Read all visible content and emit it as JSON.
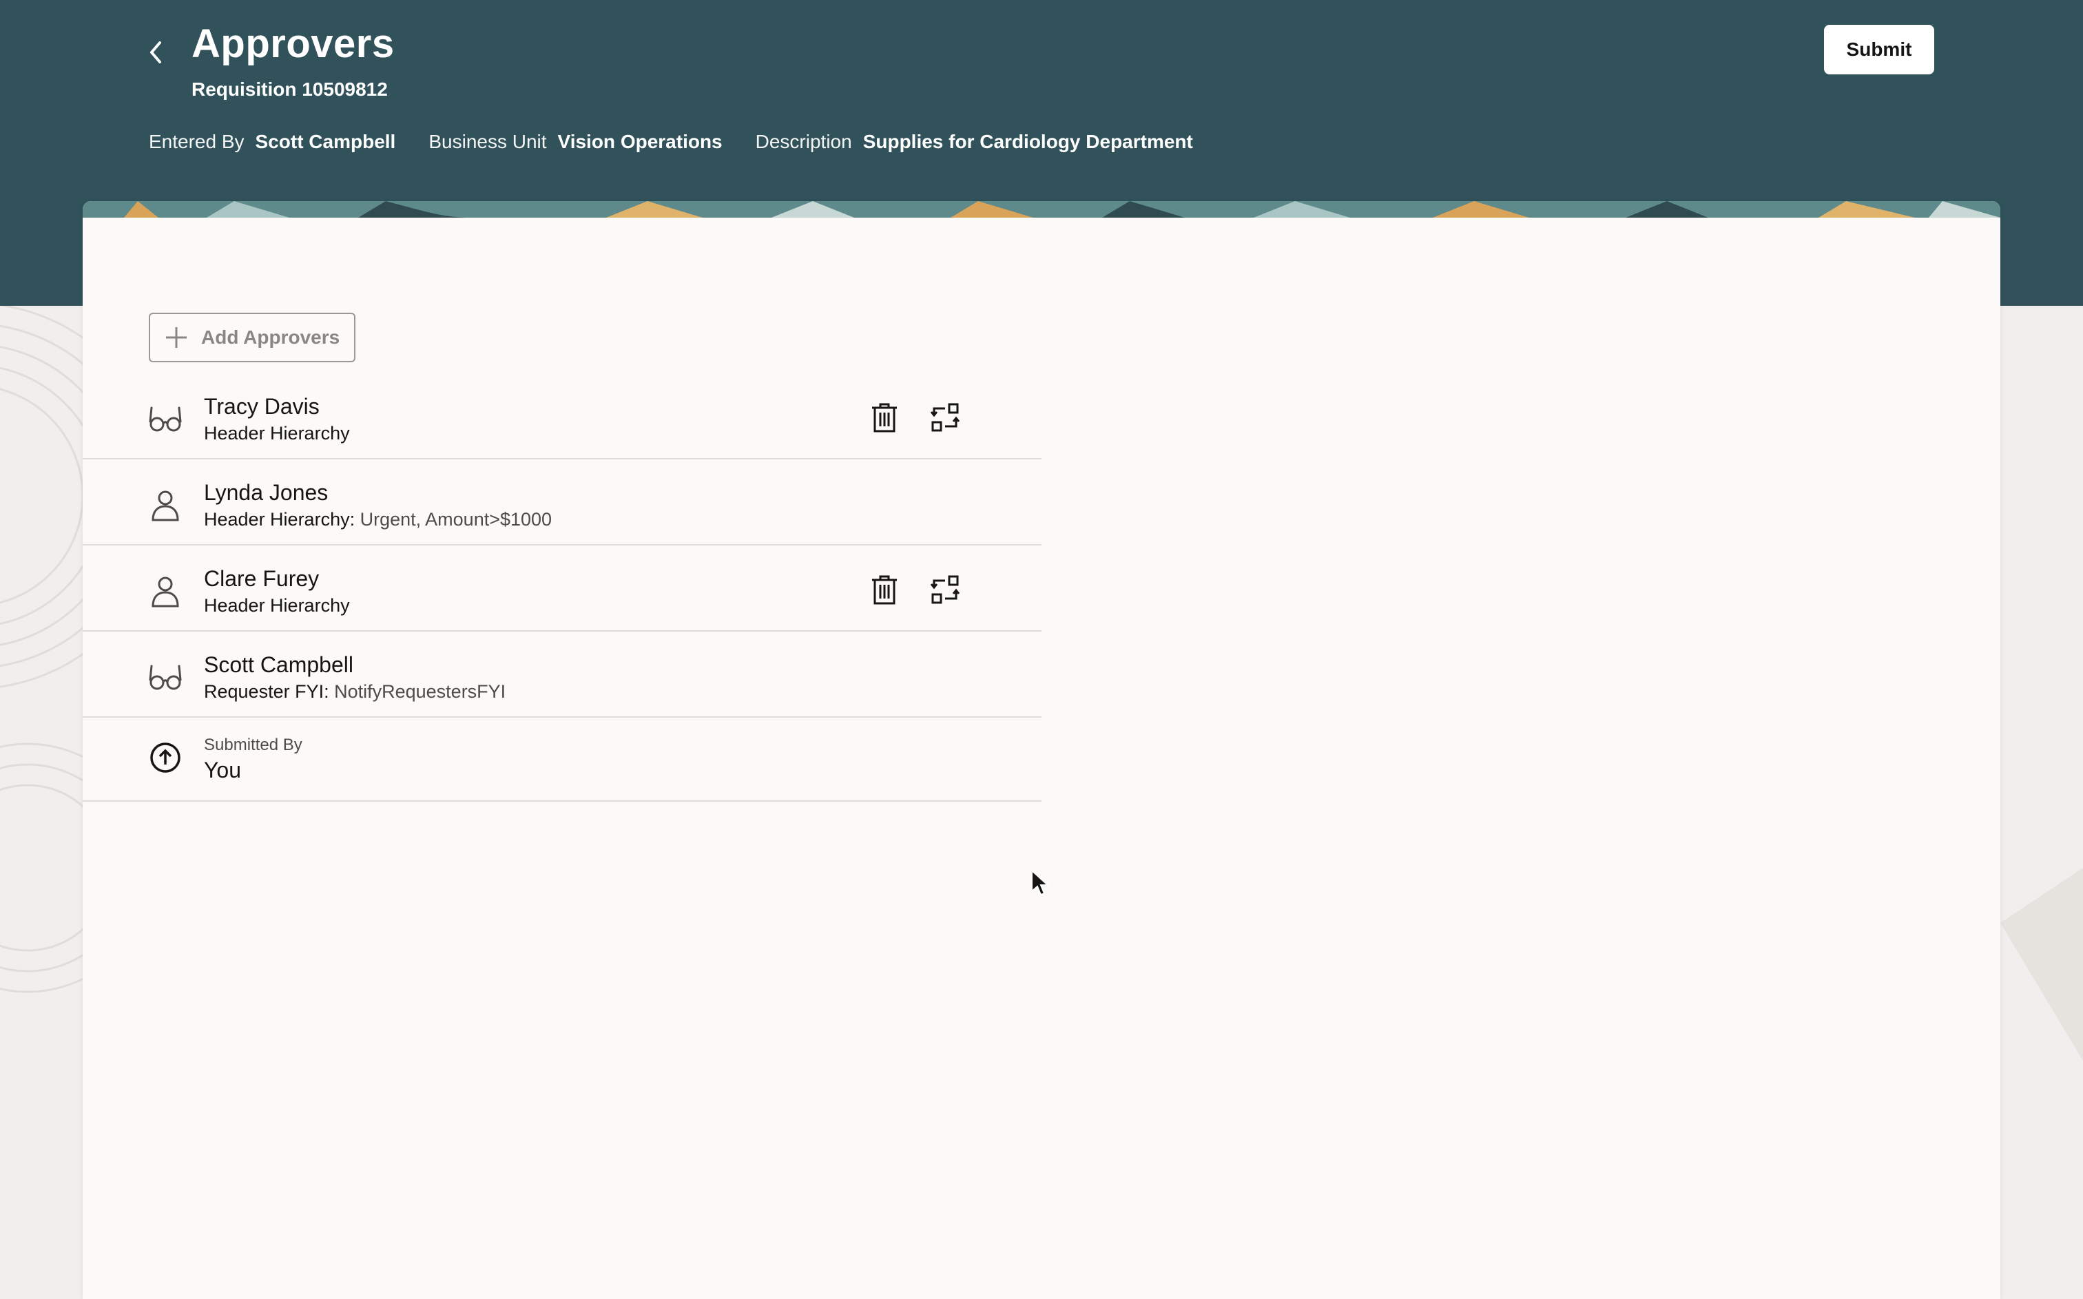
{
  "header": {
    "title": "Approvers",
    "subtitle": "Requisition 10509812",
    "submit_label": "Submit",
    "meta": {
      "entered_by_label": "Entered By",
      "entered_by_value": "Scott Campbell",
      "business_unit_label": "Business Unit",
      "business_unit_value": "Vision Operations",
      "description_label": "Description",
      "description_value": "Supplies for Cardiology Department"
    }
  },
  "toolbar": {
    "add_approvers_label": "Add Approvers"
  },
  "approvers": [
    {
      "name": "Tracy Davis",
      "source": "Header Hierarchy",
      "detail": "",
      "icon": "glasses-icon",
      "removable": true
    },
    {
      "name": "Lynda Jones",
      "source": "Header Hierarchy:",
      "detail": "Urgent, Amount>$1000",
      "icon": "person-icon",
      "removable": false
    },
    {
      "name": "Clare Furey",
      "source": "Header Hierarchy",
      "detail": "",
      "icon": "person-icon",
      "removable": true
    },
    {
      "name": "Scott Campbell",
      "source": "Requester FYI:",
      "detail": "NotifyRequestersFYI",
      "icon": "glasses-icon",
      "removable": false
    }
  ],
  "submitted": {
    "label": "Submitted By",
    "value": "You",
    "icon": "arrow-up-circle-icon"
  },
  "colors": {
    "header_bg": "#31525a",
    "card_bg": "#fbfaf8",
    "page_bg": "#f1efed"
  }
}
